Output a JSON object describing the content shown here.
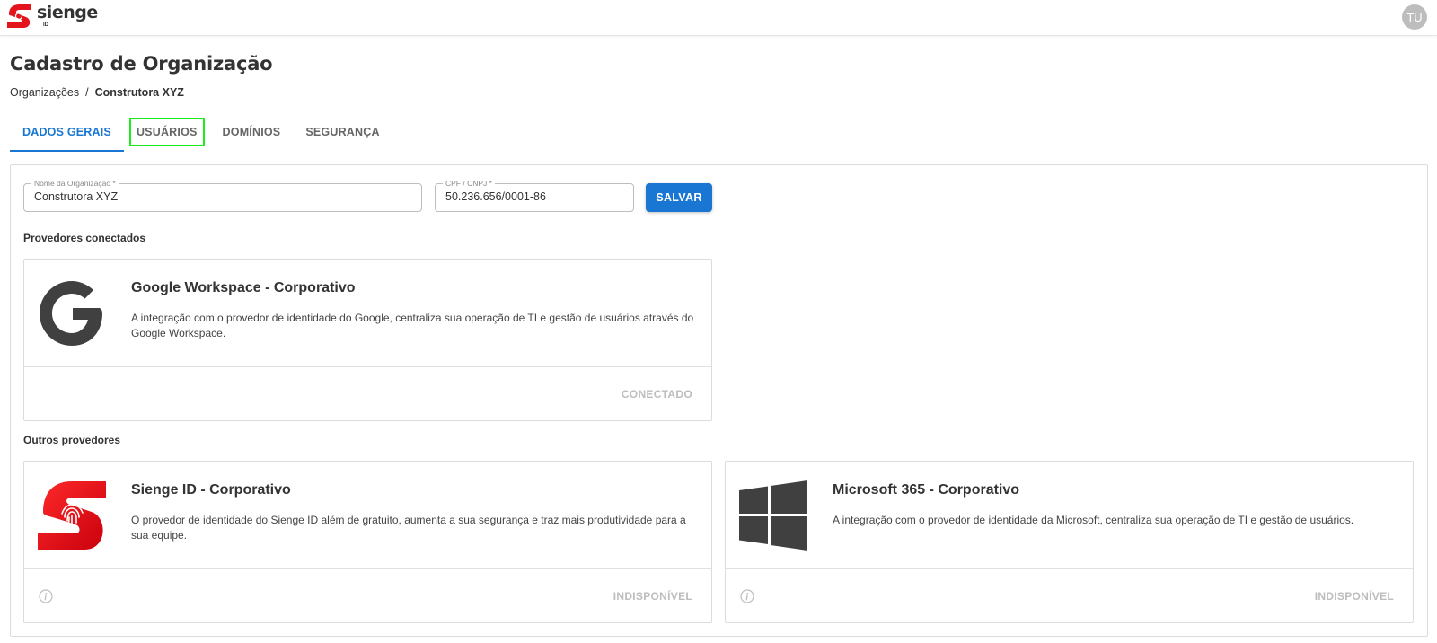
{
  "header": {
    "logo_text": "sienge",
    "logo_sub": "ID",
    "avatar_initials": "TU"
  },
  "page": {
    "title": "Cadastro de Organização",
    "breadcrumb": {
      "parent": "Organizações",
      "separator": "/",
      "current": "Construtora XYZ"
    }
  },
  "tabs": [
    {
      "label": "DADOS GERAIS",
      "active": true
    },
    {
      "label": "USUÁRIOS",
      "active": false
    },
    {
      "label": "DOMÍNIOS",
      "active": false
    },
    {
      "label": "SEGURANÇA",
      "active": false
    }
  ],
  "form": {
    "org_name_label": "Nome da Organização *",
    "org_name_value": "Construtora XYZ",
    "cnpj_label": "CPF / CNPJ *",
    "cnpj_value": "50.236.656/0001-86",
    "save_label": "SALVAR"
  },
  "connected": {
    "section_label": "Provedores conectados",
    "google": {
      "title": "Google Workspace - Corporativo",
      "description": "A integração com o provedor de identidade do Google, centraliza sua operação de TI e gestão de usuários através do Google Workspace.",
      "status": "CONECTADO"
    }
  },
  "others": {
    "section_label": "Outros provedores",
    "sienge": {
      "title": "Sienge ID - Corporativo",
      "description": "O provedor de identidade do Sienge ID além de gratuito, aumenta a sua segurança e traz mais produtividade para a sua equipe.",
      "status": "INDISPONÍVEL"
    },
    "microsoft": {
      "title": "Microsoft 365 - Corporativo",
      "description": "A integração com o provedor de identidade da Microsoft, centraliza sua operação de TI e gestão de usuários.",
      "status": "INDISPONÍVEL"
    }
  },
  "colors": {
    "primary": "#1976d2",
    "brand_red": "#e3141b",
    "highlight": "#1aeb1a",
    "muted_text": "#bdbdbd"
  }
}
